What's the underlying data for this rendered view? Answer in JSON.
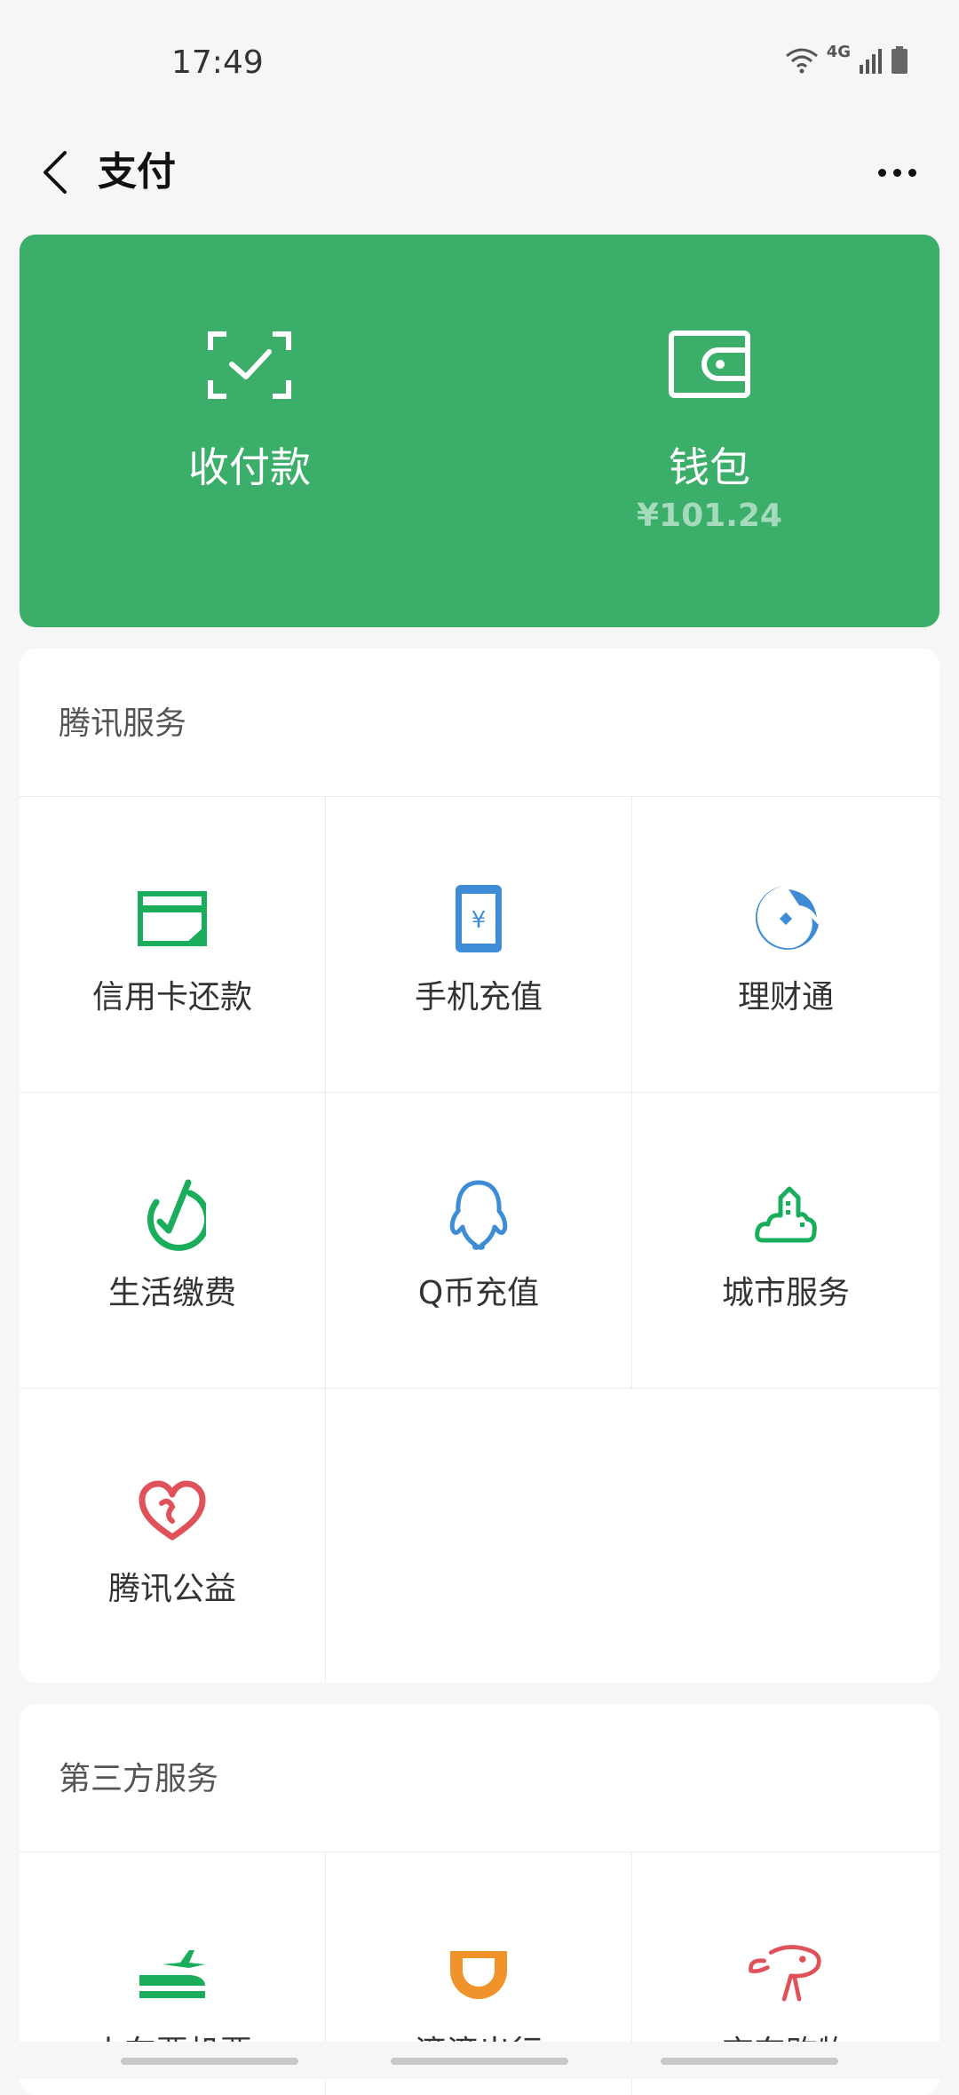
{
  "status": {
    "time": "17:49",
    "network": "4G"
  },
  "nav": {
    "title": "支付"
  },
  "card": {
    "pay_label": "收付款",
    "wallet_label": "钱包",
    "wallet_amount": "¥101.24",
    "color": "#3bae6a"
  },
  "tencent": {
    "title": "腾讯服务",
    "items": [
      {
        "label": "信用卡还款",
        "icon": "credit-card-icon",
        "color": "#1aad5c"
      },
      {
        "label": "手机充值",
        "icon": "phone-recharge-icon",
        "color": "#3f8cd6"
      },
      {
        "label": "理财通",
        "icon": "licaitong-icon",
        "color": "#3f8cd6"
      },
      {
        "label": "生活缴费",
        "icon": "utility-payment-icon",
        "color": "#1aad5c"
      },
      {
        "label": "Q币充值",
        "icon": "qq-coin-icon",
        "color": "#3f8cd6"
      },
      {
        "label": "城市服务",
        "icon": "city-service-icon",
        "color": "#1aad5c"
      },
      {
        "label": "腾讯公益",
        "icon": "charity-heart-icon",
        "color": "#e0525a"
      }
    ]
  },
  "third_party": {
    "title": "第三方服务",
    "items": [
      {
        "label": "火车票机票",
        "icon": "train-ticket-icon",
        "color": "#1aad5c"
      },
      {
        "label": "滴滴出行",
        "icon": "didi-icon",
        "color": "#f0932b"
      },
      {
        "label": "京东购物",
        "icon": "jd-dog-icon",
        "color": "#e0525a"
      }
    ]
  }
}
